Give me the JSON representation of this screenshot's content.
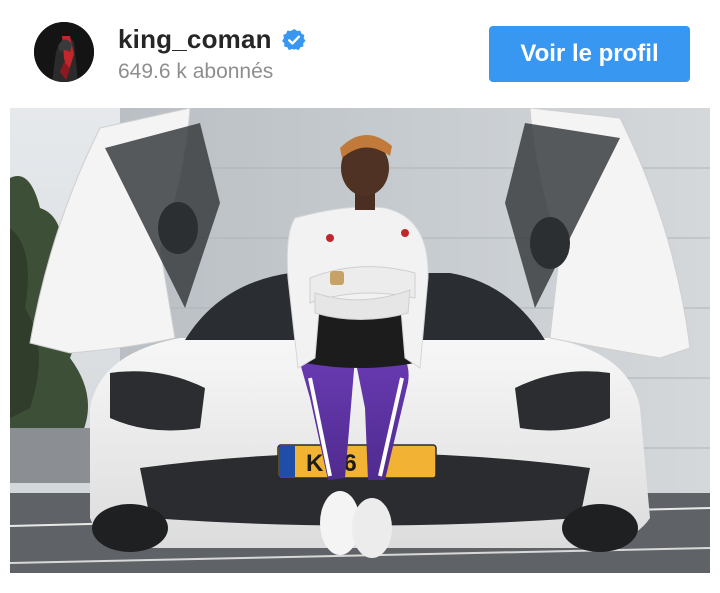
{
  "header": {
    "username": "king_coman",
    "verified": true,
    "followers": "649.6 k abonnés",
    "follow_button_label": "Voir le profil"
  },
  "post": {
    "plate_text": "K  96"
  },
  "colors": {
    "accent": "#3897f0",
    "verified_badge": "#3897f0",
    "username": "#262626",
    "secondary_text": "#8e8e8e"
  },
  "icons": {
    "verified": "verified-check-icon"
  }
}
